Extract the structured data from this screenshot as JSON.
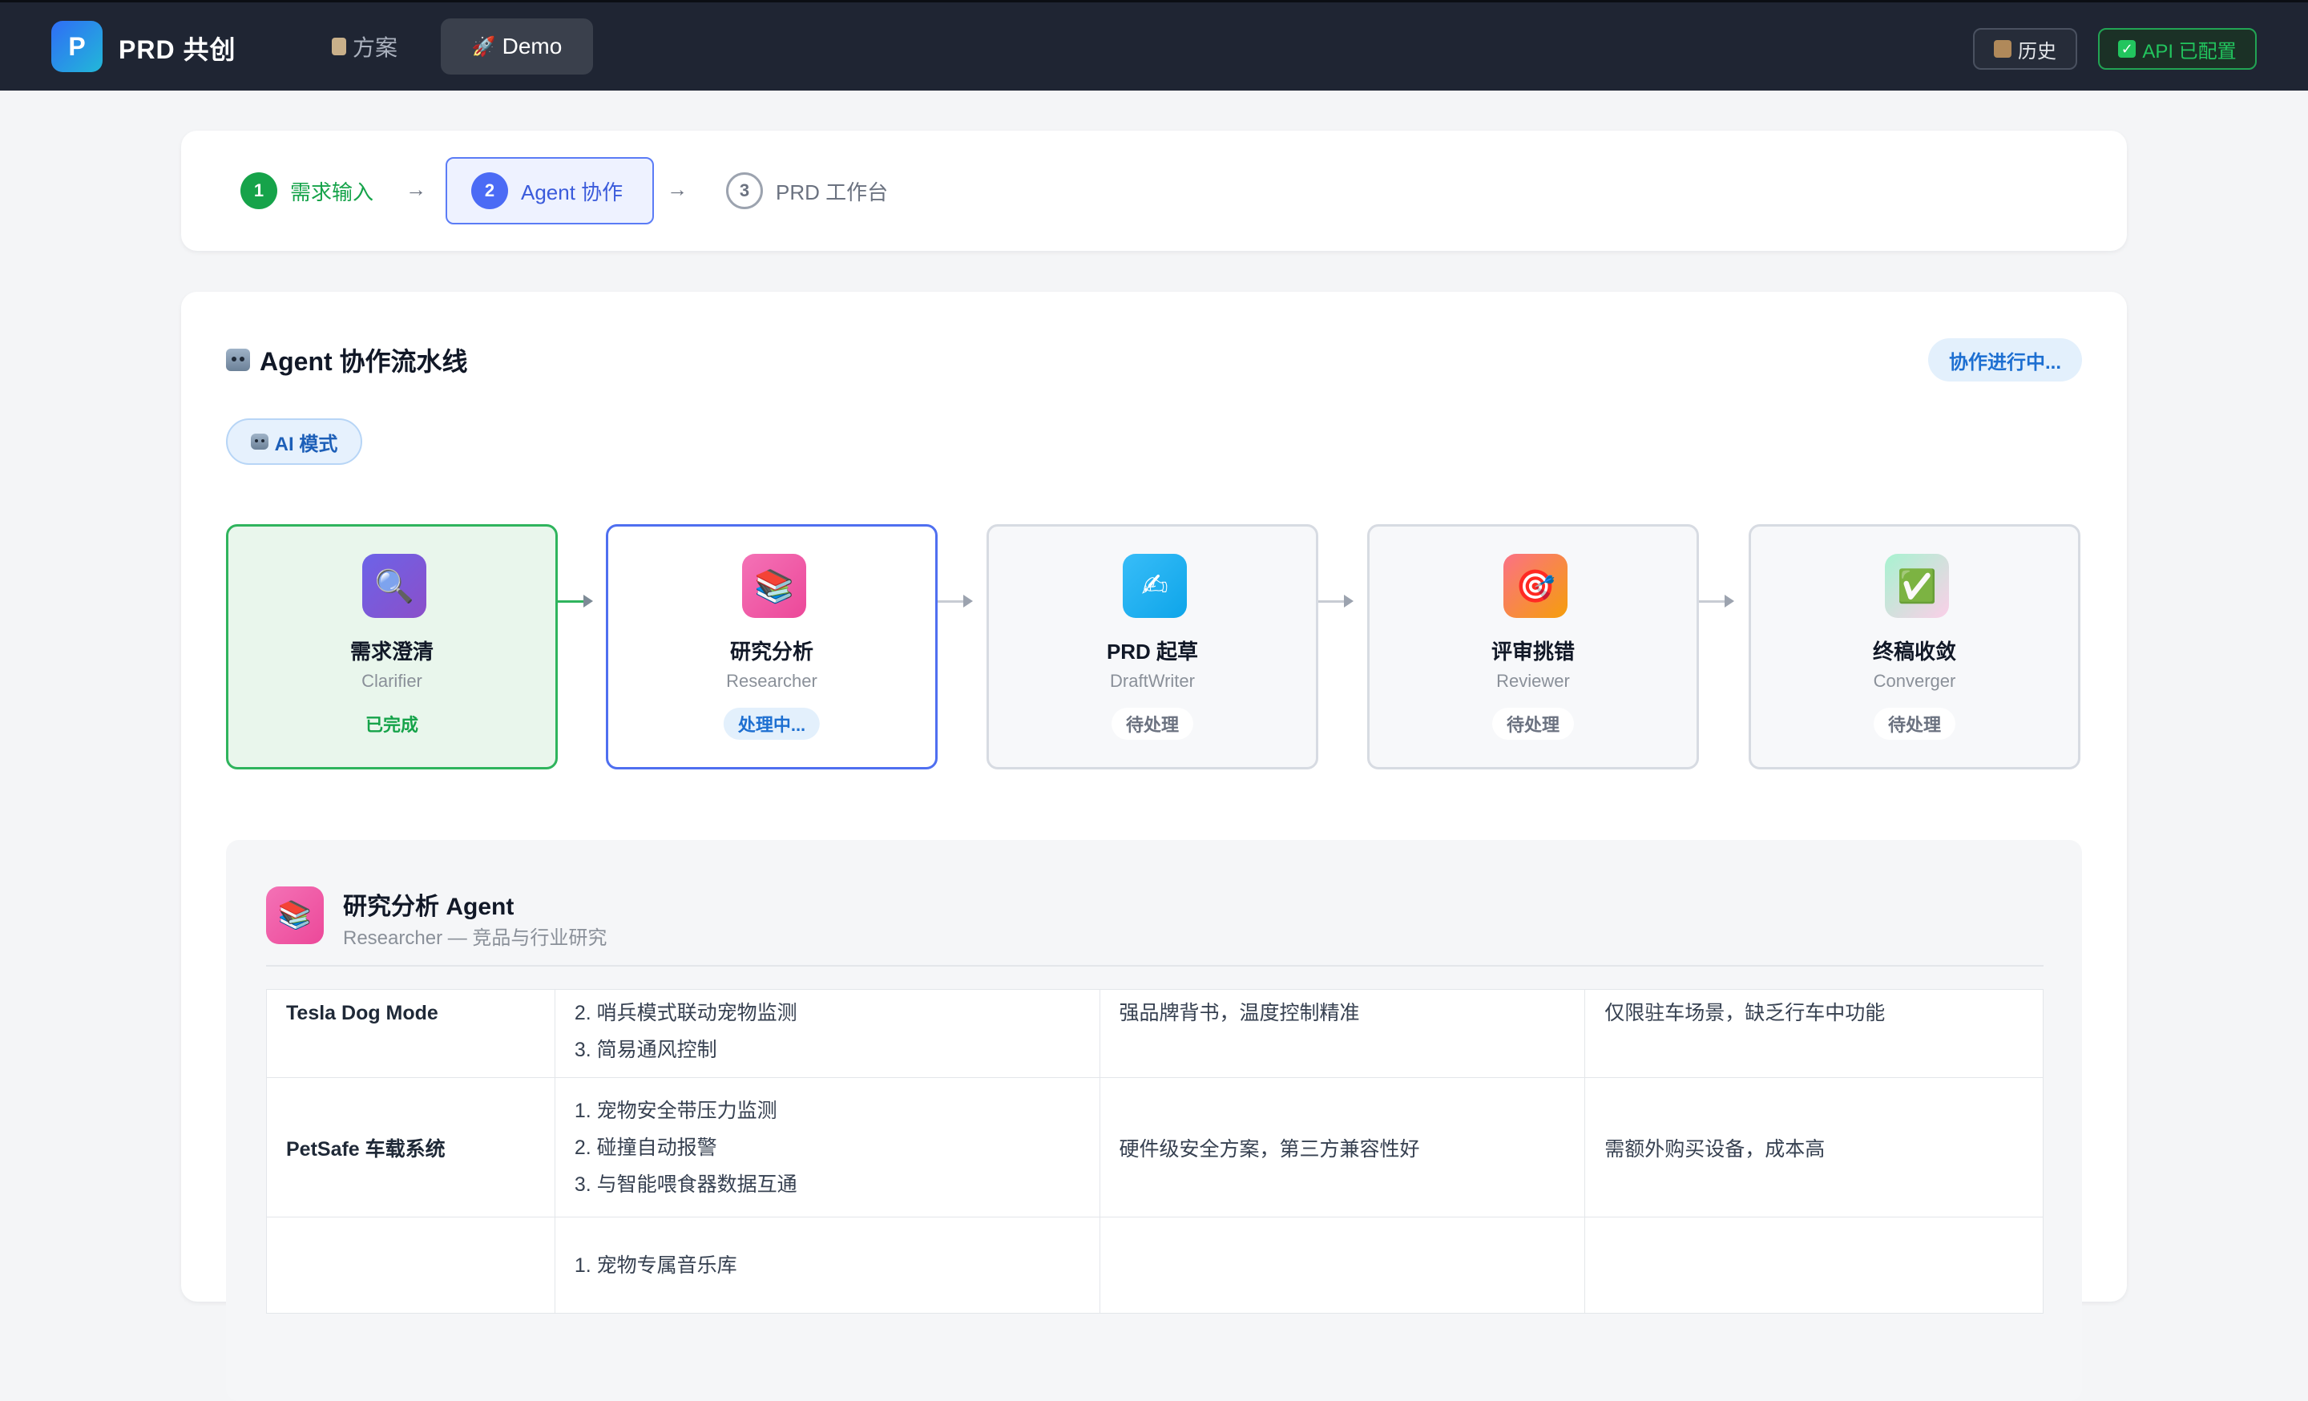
{
  "app": {
    "logo_letter": "P",
    "title": "PRD 共创"
  },
  "nav": {
    "tabs": [
      {
        "label": "方案",
        "icon": "clipboard-icon"
      },
      {
        "label": "Demo",
        "icon": "rocket-icon"
      }
    ],
    "history_label": "历史",
    "api_label": "API 已配置"
  },
  "stepper": {
    "steps": [
      {
        "num": "1",
        "label": "需求输入",
        "state": "completed"
      },
      {
        "num": "2",
        "label": "Agent 协作",
        "state": "active"
      },
      {
        "num": "3",
        "label": "PRD 工作台",
        "state": "pending"
      }
    ],
    "arrow": "→"
  },
  "pipeline": {
    "title": "Agent 协作流水线",
    "status": "协作进行中...",
    "mode": "AI 模式",
    "agents": [
      {
        "name": "需求澄清",
        "role": "Clarifier",
        "status": "已完成",
        "icon": "magnifier-icon",
        "glyph": "🔍"
      },
      {
        "name": "研究分析",
        "role": "Researcher",
        "status": "处理中...",
        "icon": "books-icon",
        "glyph": "📚"
      },
      {
        "name": "PRD 起草",
        "role": "DraftWriter",
        "status": "待处理",
        "icon": "writing-hand-icon",
        "glyph": "✍"
      },
      {
        "name": "评审挑错",
        "role": "Reviewer",
        "status": "待处理",
        "icon": "target-icon",
        "glyph": "🎯"
      },
      {
        "name": "终稿收敛",
        "role": "Converger",
        "status": "待处理",
        "icon": "check-icon",
        "glyph": "✅"
      }
    ]
  },
  "detail": {
    "title": "研究分析 Agent",
    "subtitle": "Researcher — 竞品与行业研究",
    "icon_glyph": "📚",
    "rows": [
      {
        "name": "Tesla Dog Mode",
        "features": [
          "2. 哨兵模式联动宠物监测",
          "3. 简易通风控制"
        ],
        "advantage": "强品牌背书，温度控制精准",
        "disadvantage": "仅限驻车场景，缺乏行车中功能"
      },
      {
        "name": "PetSafe 车载系统",
        "features": [
          "1. 宠物安全带压力监测",
          "2. 碰撞自动报警",
          "3. 与智能喂食器数据互通"
        ],
        "advantage": "硬件级安全方案，第三方兼容性好",
        "disadvantage": "需额外购买设备，成本高"
      },
      {
        "name": "",
        "features": [
          "1. 宠物专属音乐库"
        ],
        "advantage": "",
        "disadvantage": ""
      }
    ]
  },
  "colors": {
    "nav_bg": "#1f2533",
    "accent_blue": "#4f6ff0",
    "success_green": "#16a34a"
  }
}
